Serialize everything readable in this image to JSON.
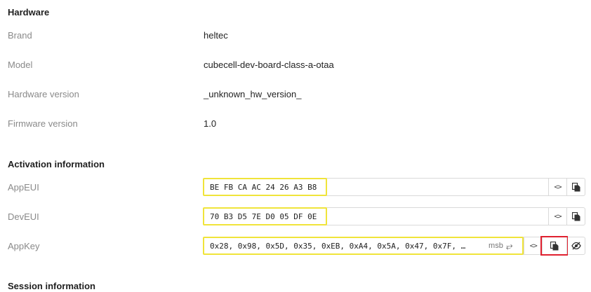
{
  "hardware": {
    "title": "Hardware",
    "rows": [
      {
        "label": "Brand",
        "value": "heltec"
      },
      {
        "label": "Model",
        "value": "cubecell-dev-board-class-a-otaa"
      },
      {
        "label": "Hardware version",
        "value": "_unknown_hw_version_"
      },
      {
        "label": "Firmware version",
        "value": "1.0"
      }
    ]
  },
  "activation": {
    "title": "Activation information",
    "app_eui": {
      "label": "AppEUI",
      "value": "BE FB CA AC 24 26 A3 B8"
    },
    "dev_eui": {
      "label": "DevEUI",
      "value": "70 B3 D5 7E D0 05 DF 0E"
    },
    "app_key": {
      "label": "AppKey",
      "value": "0x28, 0x98, 0x5D, 0x35, 0xEB, 0xA4, 0x5A, 0x47, 0x7F, …",
      "byte_order": "msb",
      "swap_icon": "⥂"
    },
    "code_icon": "<>",
    "icons": {
      "code": "code-icon",
      "copy": "copy-icon",
      "hide": "eye-off-icon",
      "swap": "swap-icon"
    }
  },
  "session": {
    "title": "Session information"
  },
  "colors": {
    "highlight_yellow": "#f0e43a",
    "highlight_red": "#e0202f"
  }
}
